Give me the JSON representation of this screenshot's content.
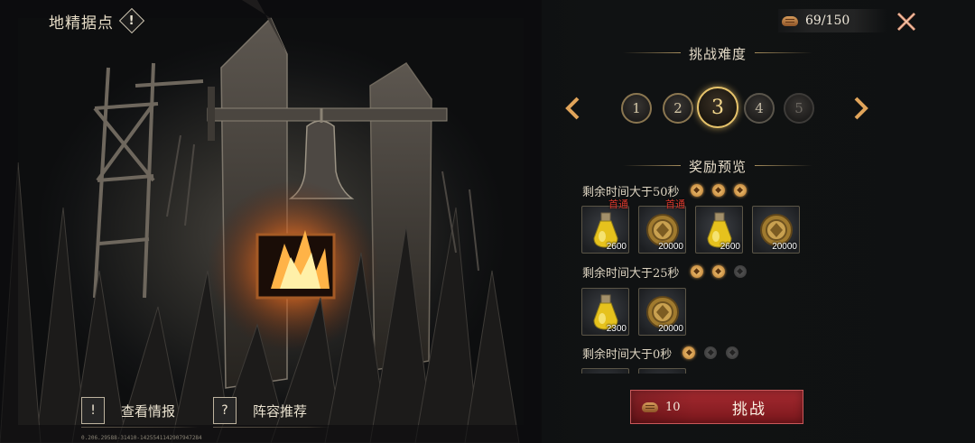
{
  "title": {
    "text": "地精据点",
    "info_icon": "exclamation-icon",
    "info_glyph": "!"
  },
  "stamina": {
    "icon": "bread-icon",
    "value": "69/150"
  },
  "difficulty": {
    "title": "挑战难度",
    "levels": [
      "1",
      "2",
      "3",
      "4",
      "5"
    ],
    "selected": "3"
  },
  "rewards": {
    "title": "奖励预览",
    "first_clear_label": "首通",
    "tiers": [
      {
        "condition": "剩余时间大于50秒",
        "stars": [
          true,
          true,
          true
        ],
        "items": [
          {
            "icon": "yellow-potion-icon",
            "qty": "2600",
            "first": true
          },
          {
            "icon": "gold-coin-icon",
            "qty": "20000",
            "first": true
          },
          {
            "icon": "yellow-potion-icon",
            "qty": "2600",
            "first": false
          },
          {
            "icon": "gold-coin-icon",
            "qty": "20000",
            "first": false
          }
        ]
      },
      {
        "condition": "剩余时间大于25秒",
        "stars": [
          true,
          true,
          false
        ],
        "items": [
          {
            "icon": "yellow-potion-icon",
            "qty": "2300",
            "first": false
          },
          {
            "icon": "gold-coin-icon",
            "qty": "20000",
            "first": false
          }
        ]
      },
      {
        "condition": "剩余时间大于0秒",
        "stars": [
          true,
          false,
          false
        ],
        "items": []
      }
    ]
  },
  "buttons": {
    "intel": {
      "label": "查看情报",
      "glyph": "!"
    },
    "lineup": {
      "label": "阵容推荐",
      "glyph": "?"
    },
    "challenge": {
      "label": "挑战",
      "cost": "10"
    }
  },
  "build_id": "0.206.29588-31410-1425541142907947284",
  "colors": {
    "accent_gold": "#e6c36b",
    "challenge_red": "#a52a30",
    "first_clear_red": "#d6382d",
    "panel_bg": "#0f1112"
  }
}
